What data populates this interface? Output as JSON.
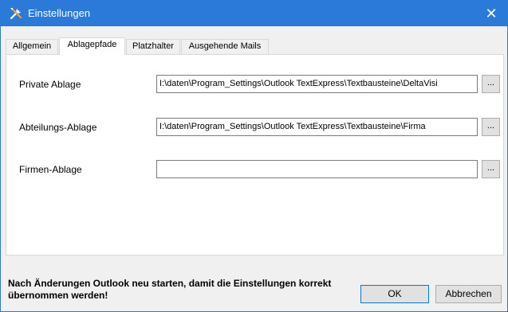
{
  "window": {
    "title": "Einstellungen"
  },
  "tabs": [
    {
      "label": "Allgemein"
    },
    {
      "label": "Ablagepfade"
    },
    {
      "label": "Platzhalter"
    },
    {
      "label": "Ausgehende Mails"
    }
  ],
  "active_tab": "Ablagepfade",
  "fields": [
    {
      "label": "Private Ablage",
      "value": "I:\\daten\\Program_Settings\\Outlook TextExpress\\Textbausteine\\DeltaVisi",
      "browse": "..."
    },
    {
      "label": "Abteilungs-Ablage",
      "value": "I:\\daten\\Program_Settings\\Outlook TextExpress\\Textbausteine\\Firma",
      "browse": "..."
    },
    {
      "label": "Firmen-Ablage",
      "value": "",
      "browse": "..."
    }
  ],
  "footer": {
    "message_line1": "Nach Änderungen Outlook neu starten, damit die Einstellungen korrekt",
    "message_line2": "übernommen werden!",
    "ok_label": "OK",
    "cancel_label": "Abbrechen"
  },
  "colors": {
    "titlebar": "#2b79d8",
    "accent": "#0078d7"
  },
  "icons": {
    "title": "tools-icon",
    "close": "close-icon"
  }
}
